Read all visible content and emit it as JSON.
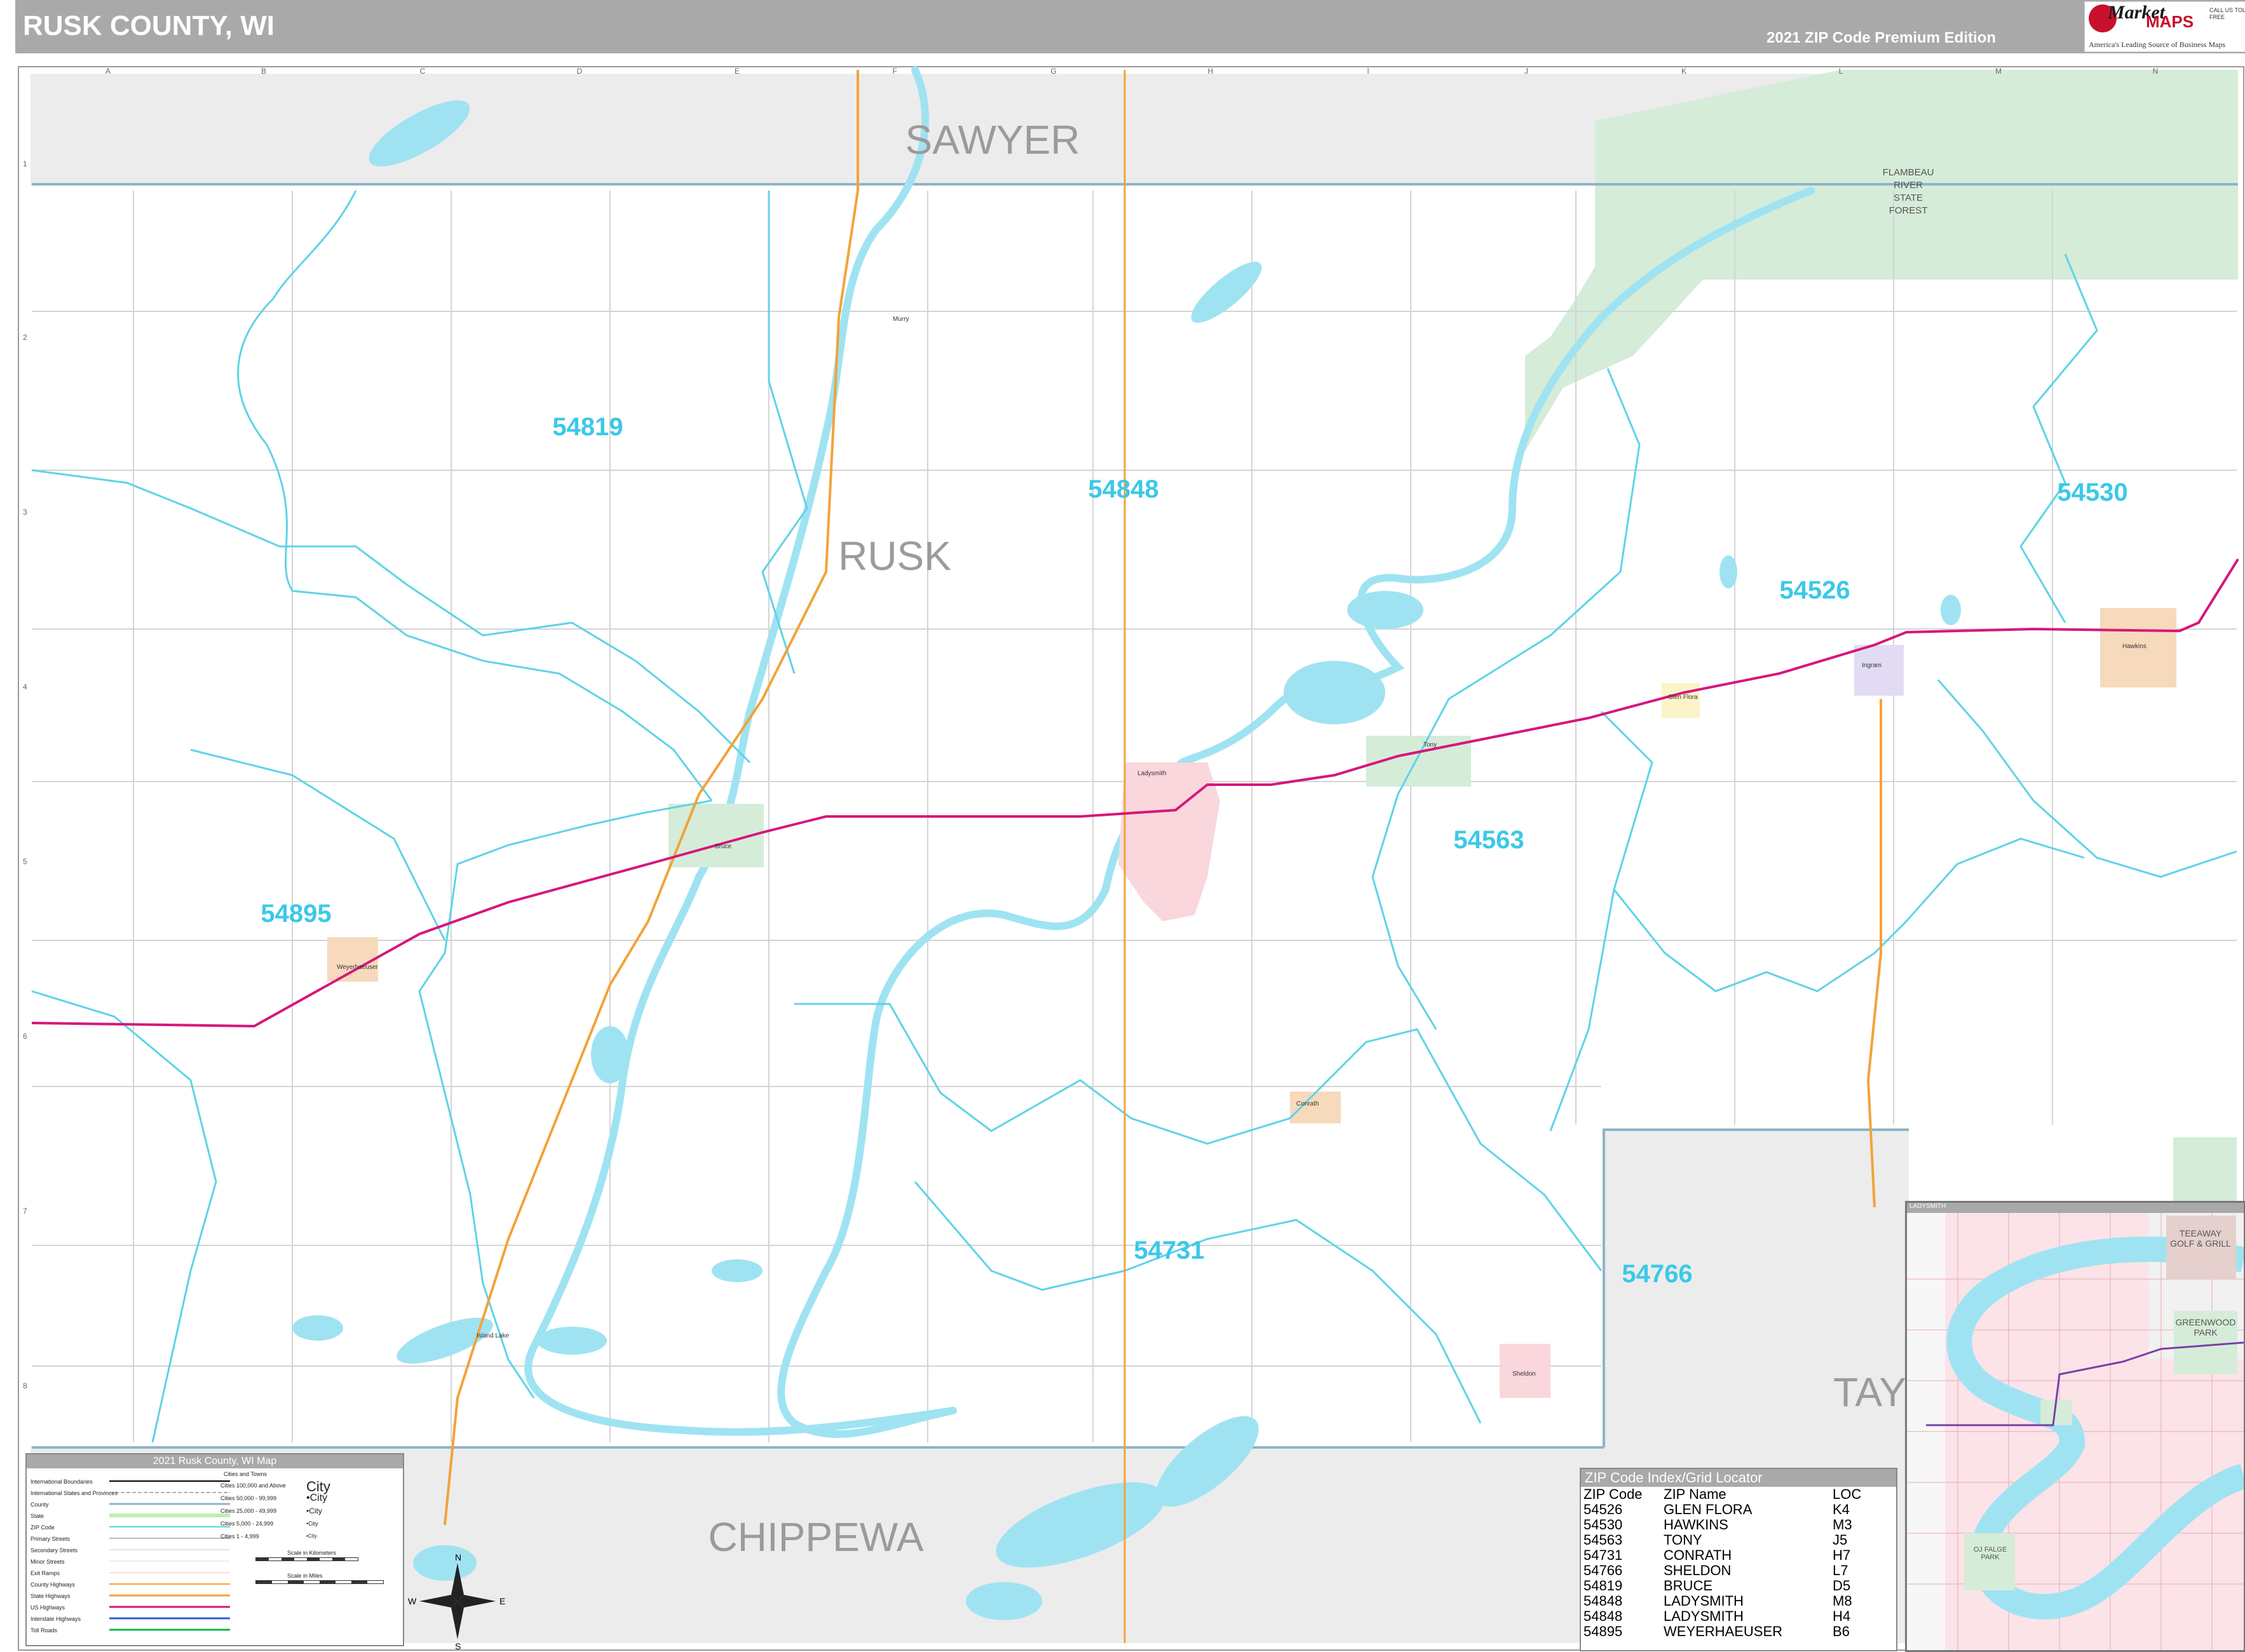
{
  "header": {
    "title": "RUSK COUNTY, WI",
    "edition": "2021 ZIP Code Premium Edition",
    "brand_name_1": "Market",
    "brand_name_2": "MAPS",
    "brand_tagline": "America's Leading Source of Business Maps",
    "brand_contact": "CALL US TOLL FREE"
  },
  "colors": {
    "zip_boundary": "#5fd3e8",
    "water": "#9fe3f2",
    "us_highway": "#d6177c",
    "state_highway": "#f2a33a",
    "county_gray": "#ececec",
    "forest_green": "#d5ecd9",
    "county_line": "#8fb3c8"
  },
  "grid": {
    "columns": [
      "A",
      "B",
      "C",
      "D",
      "E",
      "F",
      "G",
      "H",
      "I",
      "J",
      "K",
      "L",
      "M",
      "N"
    ],
    "rows": [
      "1",
      "2",
      "3",
      "4",
      "5",
      "6",
      "7",
      "8"
    ]
  },
  "map": {
    "county_labels": [
      {
        "id": "sawyer",
        "text": "SAWYER"
      },
      {
        "id": "rusk",
        "text": "RUSK"
      },
      {
        "id": "chippewa",
        "text": "CHIPPEWA"
      },
      {
        "id": "taylor",
        "text": "TAY"
      }
    ],
    "zip_labels": [
      {
        "id": "54819",
        "text": "54819"
      },
      {
        "id": "54848",
        "text": "54848"
      },
      {
        "id": "54530",
        "text": "54530"
      },
      {
        "id": "54526",
        "text": "54526"
      },
      {
        "id": "54563",
        "text": "54563"
      },
      {
        "id": "54895",
        "text": "54895"
      },
      {
        "id": "54731",
        "text": "54731"
      },
      {
        "id": "54766",
        "text": "54766"
      }
    ],
    "forest_label": [
      "FLAMBEAU",
      "RIVER",
      "STATE",
      "FOREST"
    ],
    "town_labels": [
      "Bruce",
      "Ladysmith",
      "Tony",
      "Hawkins",
      "Glen Flora",
      "Weyerhaeuser",
      "Conrath",
      "Sheldon",
      "Ingram",
      "Island Lake",
      "Murry",
      "Hawkins"
    ]
  },
  "legend": {
    "title": "2021 Rusk County, WI Map",
    "col_head": "Cities and Towns",
    "items": [
      "International Boundaries",
      "International States and Provinces",
      "County",
      "State",
      "ZIP Code",
      "Primary Streets",
      "Secondary Streets",
      "Minor Streets",
      "Exit Ramps",
      "County Highways",
      "State Highways",
      "US Highways",
      "Interstate Highways",
      "Toll Roads"
    ],
    "city_classes": [
      {
        "label": "Cities 100,000 and Above",
        "sample": "City"
      },
      {
        "label": "Cities 50,000 - 99,999",
        "sample": "•City"
      },
      {
        "label": "Cities 25,000 - 49,999",
        "sample": "•City"
      },
      {
        "label": "Cities 5,000 - 24,999",
        "sample": "•City"
      },
      {
        "label": "Cities 1 - 4,999",
        "sample": "•City"
      }
    ],
    "scale_km": "Scale in Kilometers",
    "scale_mi": "Scale in Miles",
    "compass": {
      "n": "N",
      "s": "S",
      "e": "E",
      "w": "W"
    }
  },
  "zip_index": {
    "title": "ZIP Code Index/Grid Locator",
    "headers": [
      "ZIP Code",
      "ZIP Name",
      "LOC"
    ],
    "rows": [
      [
        "54526",
        "GLEN FLORA",
        "K4"
      ],
      [
        "54530",
        "HAWKINS",
        "M3"
      ],
      [
        "54563",
        "TONY",
        "J5"
      ],
      [
        "54731",
        "CONRATH",
        "H7"
      ],
      [
        "54766",
        "SHELDON",
        "L7"
      ],
      [
        "54819",
        "BRUCE",
        "D5"
      ],
      [
        "54848",
        "LADYSMITH",
        "M8"
      ],
      [
        "54848",
        "LADYSMITH",
        "H4"
      ],
      [
        "54895",
        "WEYERHAEUSER",
        "B6"
      ]
    ]
  },
  "inset": {
    "title": "LADYSMITH",
    "labels": [
      "TEEAWAY GOLF & GRILL",
      "GREENWOOD PARK",
      "OJ FALGE PARK"
    ]
  }
}
